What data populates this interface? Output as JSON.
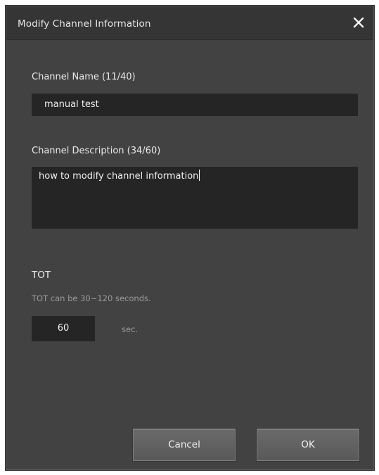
{
  "dialog": {
    "title": "Modify Channel Information",
    "close_icon": "close-icon"
  },
  "channel_name": {
    "label": "Channel Name (11/40)",
    "value": "manual test"
  },
  "channel_description": {
    "label": "Channel Description (34/60)",
    "value": "how to modify channel information"
  },
  "tot": {
    "title": "TOT",
    "hint": "TOT can be 30~120 seconds.",
    "value": "60",
    "unit": "sec."
  },
  "buttons": {
    "cancel": "Cancel",
    "ok": "OK"
  }
}
